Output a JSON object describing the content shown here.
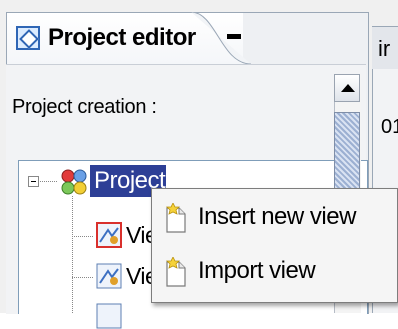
{
  "editor": {
    "tab_title": "Project editor",
    "section_label": "Project creation :"
  },
  "tree": {
    "root_label": "Project",
    "children": [
      {
        "label": "Vie"
      },
      {
        "label": "Vie"
      },
      {
        "label": ""
      }
    ]
  },
  "right_panel": {
    "tab_label": "ir",
    "text": "01"
  },
  "context_menu": {
    "items": [
      {
        "label": "Insert new view",
        "icon": "new-view-icon"
      },
      {
        "label": "Import view",
        "icon": "import-view-icon"
      }
    ]
  },
  "colors": {
    "selection": "#2d3f96",
    "panel_border": "#9aa7b6"
  }
}
